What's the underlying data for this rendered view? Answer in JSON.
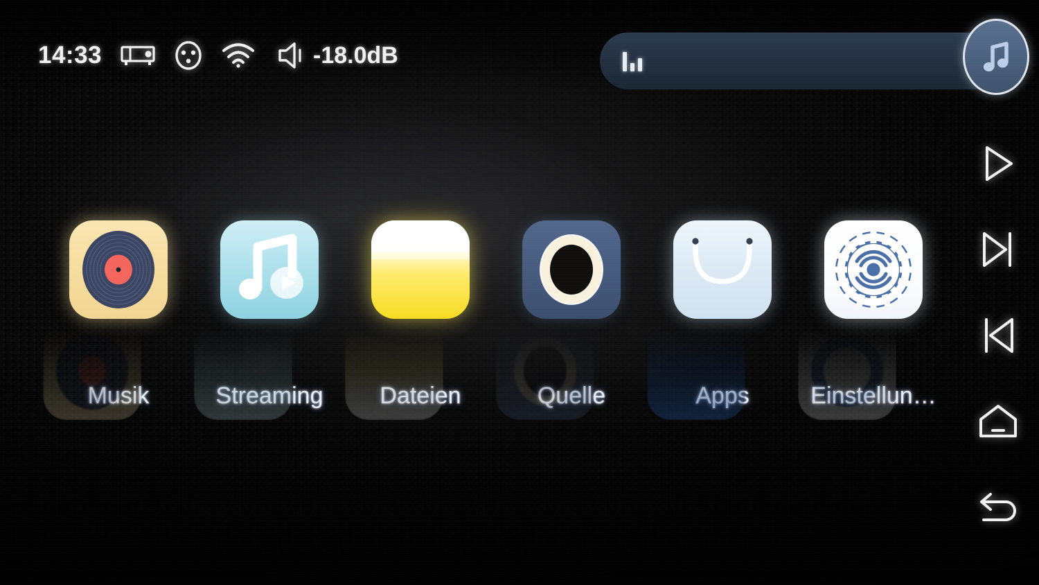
{
  "status_bar": {
    "clock": "14:33",
    "icons": [
      {
        "name": "media-receiver-icon",
        "label": "media receiver"
      },
      {
        "name": "xlr-connector-icon",
        "label": "XLR connector"
      },
      {
        "name": "wifi-icon",
        "label": "wifi connected"
      },
      {
        "name": "volume-icon",
        "label": "volume"
      }
    ],
    "volume_level": "-18.0dB"
  },
  "now_playing": {
    "equalizer_icon": "equalizer-bars-icon",
    "track_title": "",
    "music_button_icon": "music-note-icon"
  },
  "apps": [
    {
      "label": "Musik",
      "icon": "vinyl-record-icon",
      "tile_class": "tile-musik"
    },
    {
      "label": "Streaming",
      "icon": "music-note-play-icon",
      "tile_class": "tile-streaming"
    },
    {
      "label": "Dateien",
      "icon": "folder-icon",
      "tile_class": "tile-dateien"
    },
    {
      "label": "Quelle",
      "icon": "source-ring-icon",
      "tile_class": "tile-quelle"
    },
    {
      "label": "Apps",
      "icon": "shopping-bag-icon",
      "tile_class": "tile-apps"
    },
    {
      "label": "Einstellun…",
      "icon": "gear-icon",
      "tile_class": "tile-einstellungen"
    }
  ],
  "nav_bar": [
    {
      "name": "play-button",
      "icon": "play-icon"
    },
    {
      "name": "next-track-button",
      "icon": "skip-next-icon"
    },
    {
      "name": "previous-track-button",
      "icon": "skip-previous-icon"
    },
    {
      "name": "home-button",
      "icon": "home-icon"
    },
    {
      "name": "back-button",
      "icon": "back-arrow-icon"
    }
  ],
  "colors": {
    "background": "#050505",
    "label_text": "#e8eefb",
    "status_text": "#f2f2f2",
    "now_playing_bar": "#22303f",
    "accent_blue": "#4d6280",
    "musik_tile": "#f6dda0",
    "streaming_tile": "#a9dfea",
    "dateien_tile": "#f7dc23",
    "quelle_tile": "#465a7e",
    "apps_tile": "#dbe9f4",
    "einstellungen_tile": "#ffffff"
  }
}
